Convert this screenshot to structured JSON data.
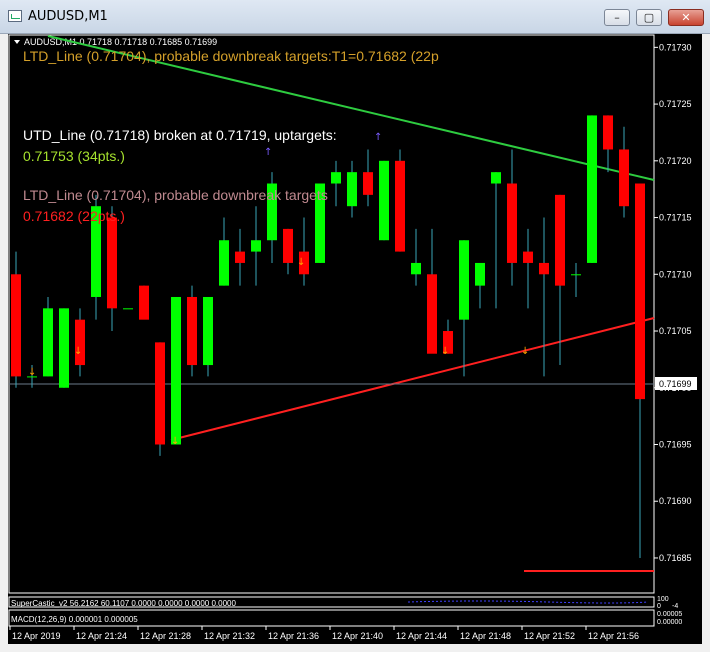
{
  "window": {
    "title": "AUDUSD,M1",
    "min_glyph": "–",
    "max_glyph": "▢",
    "close_glyph": "✕"
  },
  "chart": {
    "header": "AUDUSD,M1  0.71718 0.71718 0.71685 0.71699",
    "current_price": "0.71699",
    "price_axis": [
      "0.71730",
      "0.71725",
      "0.71720",
      "0.71715",
      "0.71710",
      "0.71705",
      "0.71700",
      "0.71695",
      "0.71690",
      "0.71685"
    ],
    "time_axis": [
      "12 Apr 2019",
      "12 Apr 21:24",
      "12 Apr 21:28",
      "12 Apr 21:32",
      "12 Apr 21:36",
      "12 Apr 21:40",
      "12 Apr 21:44",
      "12 Apr 21:48",
      "12 Apr 21:52",
      "12 Apr 21:56"
    ],
    "annotations": {
      "ltd_top": "LTD_Line (0.71704), probable downbreak targets:T1=0.71682 (22p",
      "utd_line": "UTD_Line (0.71718) broken at 0.71719, uptargets:",
      "utd_target": "0.71753 (34pts.)",
      "ltd_mid": "LTD_Line (0.71704), probable downbreak targets",
      "ltd_target": "0.71682 (22pts.)"
    },
    "indicators": {
      "supercastic": "SuperCastic_v2 56.2162 60.1107 0.0000 0.0000 0.0000 0.0000",
      "macd": "MACD(12,26,9) 0.000001 0.000005",
      "sub_axis": [
        "100",
        "0",
        "-4",
        "0.00005",
        "0.00000"
      ]
    },
    "colors": {
      "bull": "#00ff00",
      "bear": "#ff0000",
      "wick": "#3aa6b8",
      "up_trend": "#2ecc40",
      "down_trend": "#ff2020",
      "grid": "#ffffff"
    }
  },
  "chart_data": {
    "type": "candlestick",
    "y_range": [
      0.71682,
      0.71731
    ],
    "candles": [
      {
        "o": 0.7171,
        "h": 0.71712,
        "l": 0.717,
        "c": 0.71701
      },
      {
        "o": 0.71701,
        "h": 0.71702,
        "l": 0.717,
        "c": 0.71701
      },
      {
        "o": 0.71701,
        "h": 0.71708,
        "l": 0.71701,
        "c": 0.71707
      },
      {
        "o": 0.717,
        "h": 0.71707,
        "l": 0.717,
        "c": 0.71707
      },
      {
        "o": 0.71706,
        "h": 0.71707,
        "l": 0.71701,
        "c": 0.71702
      },
      {
        "o": 0.71708,
        "h": 0.71717,
        "l": 0.71706,
        "c": 0.71716
      },
      {
        "o": 0.71715,
        "h": 0.71716,
        "l": 0.71705,
        "c": 0.71707
      },
      {
        "o": 0.71707,
        "h": 0.71707,
        "l": 0.71707,
        "c": 0.71707
      },
      {
        "o": 0.71709,
        "h": 0.71709,
        "l": 0.71707,
        "c": 0.71706
      },
      {
        "o": 0.71704,
        "h": 0.71704,
        "l": 0.71694,
        "c": 0.71695
      },
      {
        "o": 0.71695,
        "h": 0.71708,
        "l": 0.71695,
        "c": 0.71708
      },
      {
        "o": 0.71708,
        "h": 0.71709,
        "l": 0.71701,
        "c": 0.71702
      },
      {
        "o": 0.71702,
        "h": 0.71708,
        "l": 0.71701,
        "c": 0.71708
      },
      {
        "o": 0.71709,
        "h": 0.71715,
        "l": 0.71709,
        "c": 0.71713
      },
      {
        "o": 0.71712,
        "h": 0.71714,
        "l": 0.71709,
        "c": 0.71711
      },
      {
        "o": 0.71712,
        "h": 0.71716,
        "l": 0.71709,
        "c": 0.71713
      },
      {
        "o": 0.71713,
        "h": 0.71719,
        "l": 0.71711,
        "c": 0.71718
      },
      {
        "o": 0.71714,
        "h": 0.71714,
        "l": 0.7171,
        "c": 0.71711
      },
      {
        "o": 0.71712,
        "h": 0.71715,
        "l": 0.71709,
        "c": 0.7171
      },
      {
        "o": 0.71711,
        "h": 0.71718,
        "l": 0.71711,
        "c": 0.71718
      },
      {
        "o": 0.71718,
        "h": 0.7172,
        "l": 0.71716,
        "c": 0.71719
      },
      {
        "o": 0.71716,
        "h": 0.7172,
        "l": 0.71715,
        "c": 0.71719
      },
      {
        "o": 0.71719,
        "h": 0.71721,
        "l": 0.71716,
        "c": 0.71717
      },
      {
        "o": 0.71713,
        "h": 0.7172,
        "l": 0.71713,
        "c": 0.7172
      },
      {
        "o": 0.7172,
        "h": 0.71721,
        "l": 0.71712,
        "c": 0.71712
      },
      {
        "o": 0.7171,
        "h": 0.71714,
        "l": 0.71709,
        "c": 0.71711
      },
      {
        "o": 0.7171,
        "h": 0.71714,
        "l": 0.71708,
        "c": 0.71703
      },
      {
        "o": 0.71705,
        "h": 0.71706,
        "l": 0.71703,
        "c": 0.71703
      },
      {
        "o": 0.71706,
        "h": 0.71713,
        "l": 0.71701,
        "c": 0.71713
      },
      {
        "o": 0.71709,
        "h": 0.71711,
        "l": 0.71707,
        "c": 0.71711
      },
      {
        "o": 0.71718,
        "h": 0.71719,
        "l": 0.71707,
        "c": 0.71719
      },
      {
        "o": 0.71718,
        "h": 0.71721,
        "l": 0.71709,
        "c": 0.71711
      },
      {
        "o": 0.71712,
        "h": 0.71714,
        "l": 0.71707,
        "c": 0.71711
      },
      {
        "o": 0.71711,
        "h": 0.71715,
        "l": 0.71701,
        "c": 0.7171
      },
      {
        "o": 0.71717,
        "h": 0.71717,
        "l": 0.71702,
        "c": 0.71709
      },
      {
        "o": 0.7171,
        "h": 0.71711,
        "l": 0.71708,
        "c": 0.7171
      },
      {
        "o": 0.71711,
        "h": 0.71724,
        "l": 0.71711,
        "c": 0.71724
      },
      {
        "o": 0.71724,
        "h": 0.71724,
        "l": 0.71719,
        "c": 0.71721
      },
      {
        "o": 0.71721,
        "h": 0.71723,
        "l": 0.71715,
        "c": 0.71716
      },
      {
        "o": 0.71718,
        "h": 0.71718,
        "l": 0.71685,
        "c": 0.71699
      }
    ]
  }
}
